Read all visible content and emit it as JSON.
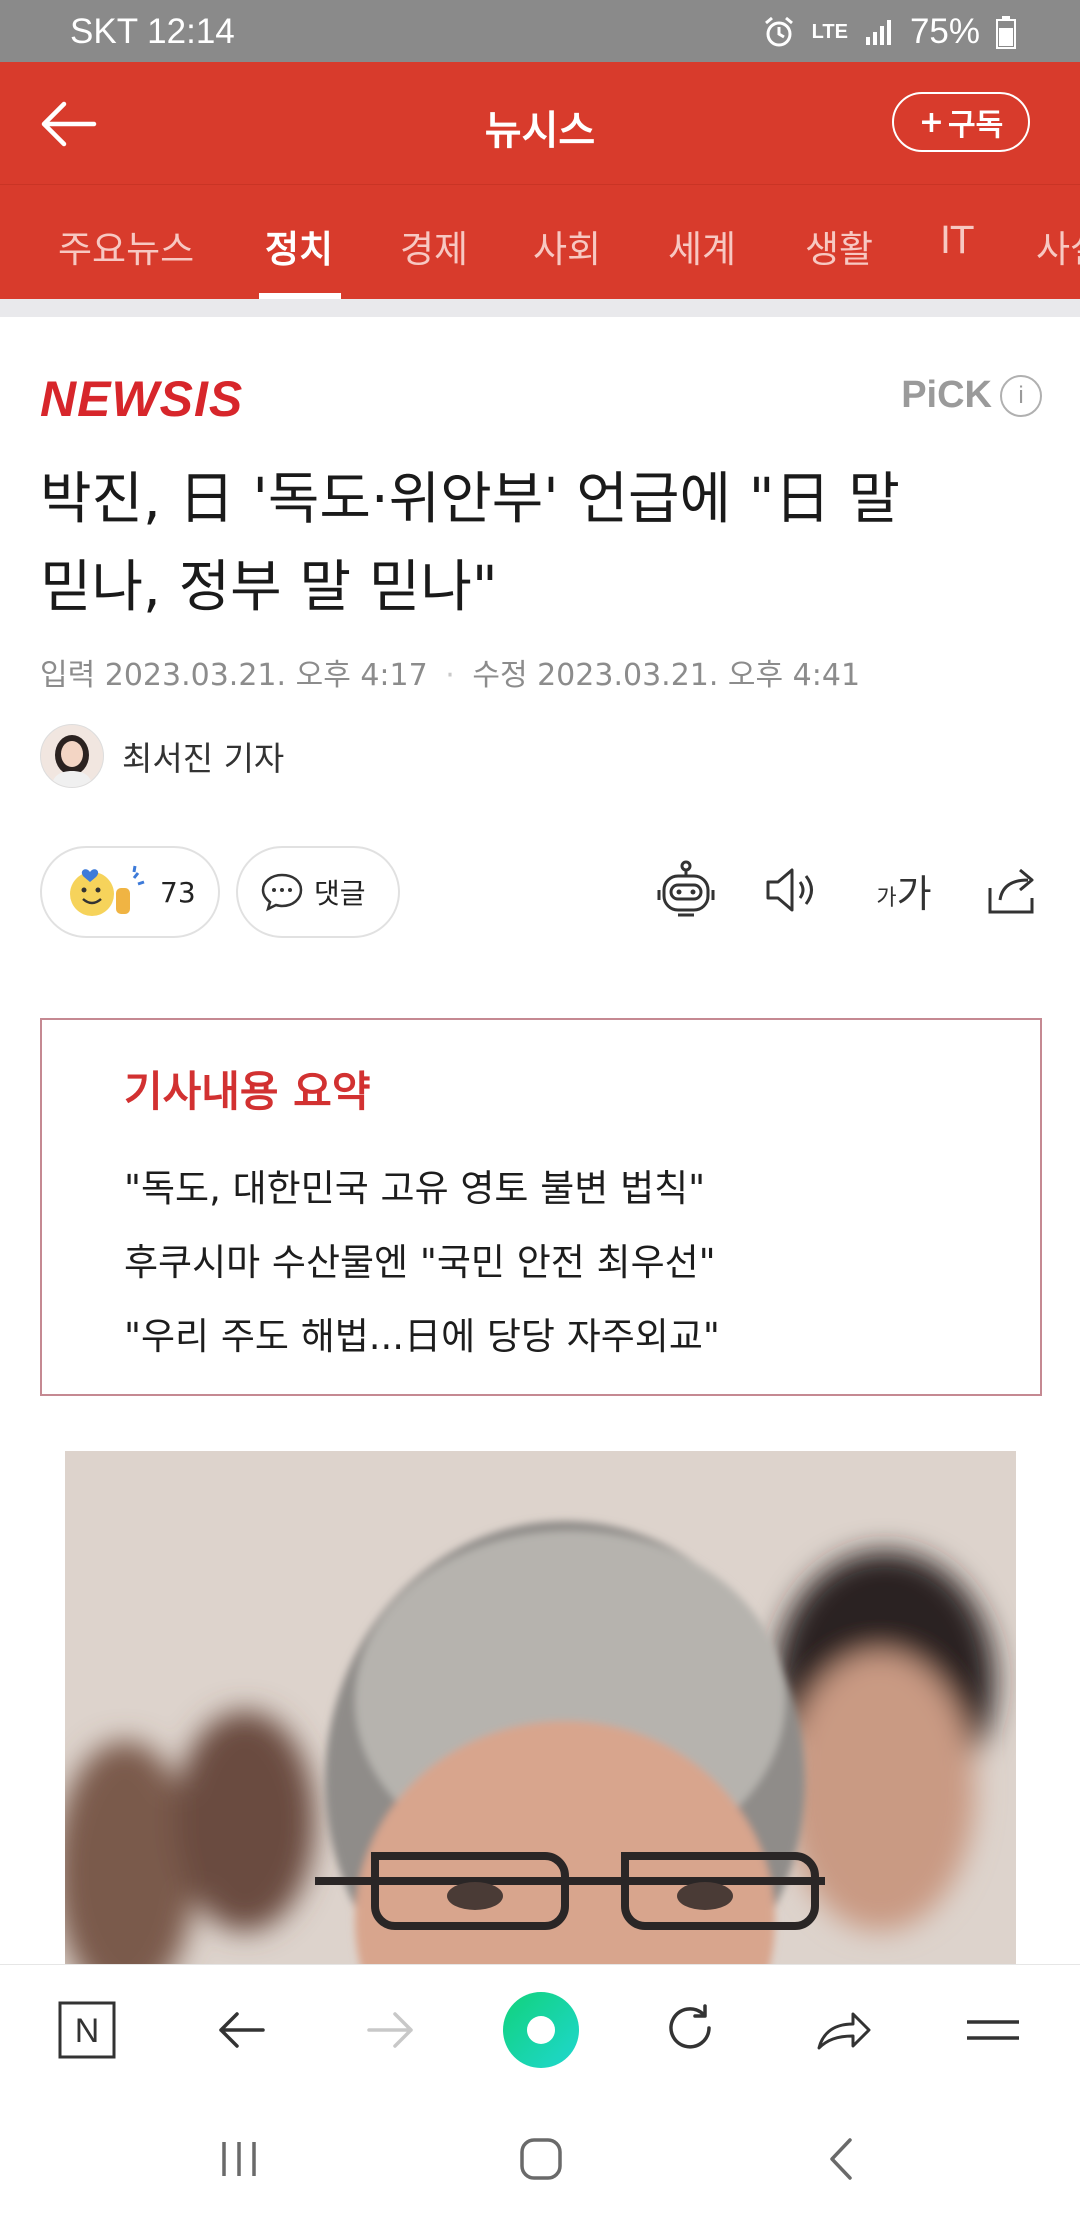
{
  "status_bar": {
    "carrier_time": "SKT 12:14",
    "network": "LTE",
    "battery": "75%"
  },
  "header": {
    "title": "뉴시스",
    "subscribe_label": "구독"
  },
  "categories": [
    "주요뉴스",
    "정치",
    "경제",
    "사회",
    "세계",
    "생활",
    "IT",
    "사설"
  ],
  "active_category": "정치",
  "article": {
    "source_logo": "NEWSIS",
    "pick_label": "PiCK",
    "pick_info": "i",
    "headline_line1": "박진, 日 '독도·위안부' 언급에 \"日 말",
    "headline_line2": "믿나, 정부 말 믿나\"",
    "input_label": "입력",
    "input_date": "2023.03.21. 오후 4:17",
    "edit_label": "수정",
    "edit_date": "2023.03.21. 오후 4:41",
    "author": "최서진 기자"
  },
  "actions": {
    "reaction_count": "73",
    "comment_label": "댓글",
    "font_size_small": "가",
    "font_size_large": "가"
  },
  "summary": {
    "title": "기사내용 요약",
    "lines": [
      "\"독도, 대한민국 고유 영토 불변 법칙\"",
      "후쿠시마 수산물엔 \"국민 안전 최우선\"",
      "\"우리 주도 해법...日에 당당 자주외교\""
    ]
  },
  "bottom_nav": {
    "home_letter": "N"
  },
  "colors": {
    "brand_red": "#d83b2c",
    "logo_red": "#d7262b",
    "summary_title": "#d23131",
    "accent_green": "#19d9a8"
  }
}
